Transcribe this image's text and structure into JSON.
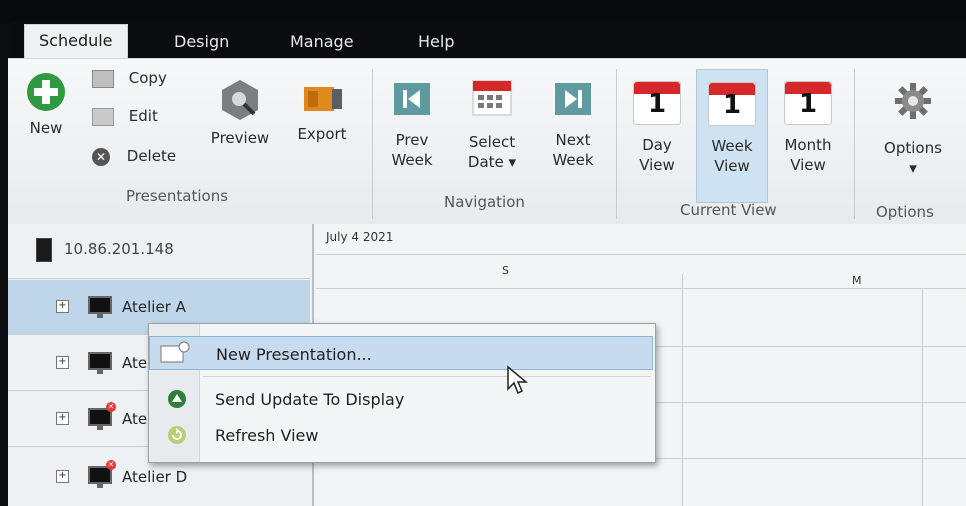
{
  "tabs": [
    {
      "label": "Schedule"
    },
    {
      "label": "Design"
    },
    {
      "label": "Manage"
    },
    {
      "label": "Help"
    }
  ],
  "ribbon": {
    "presentations": {
      "new": "New",
      "copy": "Copy",
      "edit": "Edit",
      "delete": "Delete",
      "preview": "Preview",
      "export": "Export",
      "group_label": "Presentations"
    },
    "navigation": {
      "prev_week_1": "Prev",
      "prev_week_2": "Week",
      "select_date_1": "Select",
      "select_date_2": "Date ▾",
      "next_week_1": "Next",
      "next_week_2": "Week",
      "group_label": "Navigation"
    },
    "current_view": {
      "day_1": "Day",
      "day_2": "View",
      "week_1": "Week",
      "week_2": "View",
      "month_1": "Month",
      "month_2": "View",
      "cal_number": "1",
      "group_label": "Current View"
    },
    "options": {
      "label": "Options",
      "arrow": "▾",
      "group_label": "Options"
    }
  },
  "tree": {
    "server": "10.86.201.148",
    "items": [
      {
        "label": "Atelier A",
        "expander": "+"
      },
      {
        "label": "Ate",
        "expander": "+"
      },
      {
        "label": "Ate",
        "expander": "+"
      },
      {
        "label": "Atelier D",
        "expander": "+"
      }
    ]
  },
  "calendar": {
    "date_label": "July 4 2021",
    "day_markers": [
      "S",
      "M"
    ]
  },
  "context_menu": {
    "items": [
      {
        "label": "New Presentation..."
      },
      {
        "label": "Send Update To Display"
      },
      {
        "label": "Refresh View"
      }
    ]
  }
}
